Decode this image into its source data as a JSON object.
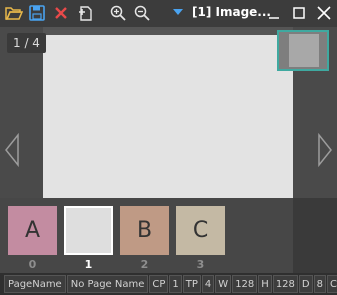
{
  "titlebar": {
    "title": "[1] Image...",
    "accent_color": "#4aa3f0",
    "icons": [
      "open-folder-icon",
      "save-icon",
      "close-image-icon",
      "add-page-icon",
      "zoom-in-icon",
      "zoom-out-icon",
      "dropdown-icon"
    ],
    "window_controls": [
      "minimize-icon",
      "maximize-icon",
      "close-icon"
    ]
  },
  "viewer": {
    "page_counter": "1 / 4",
    "nav_prev_icon": "chevron-left-icon",
    "nav_next_icon": "chevron-right-icon",
    "minimap_border_color": "#3fa9a0"
  },
  "thumbnails": [
    {
      "letter": "A",
      "index": "0",
      "color": "#c38ca1",
      "selected": false
    },
    {
      "letter": "",
      "index": "1",
      "color": "#dedede",
      "selected": true
    },
    {
      "letter": "B",
      "index": "2",
      "color": "#bf9a85",
      "selected": false
    },
    {
      "letter": "C",
      "index": "3",
      "color": "#c4b9a4",
      "selected": false
    }
  ],
  "statusbar": {
    "page_name_label": "PageName",
    "page_name_value": "No Page Name",
    "cp_label": "CP",
    "cp_value": "1",
    "tp_label": "TP",
    "tp_value": "4",
    "w_label": "W",
    "w_value": "128",
    "h_label": "H",
    "h_value": "128",
    "d_label": "D",
    "d_value": "8",
    "c_label": "C",
    "c_value": "1"
  }
}
